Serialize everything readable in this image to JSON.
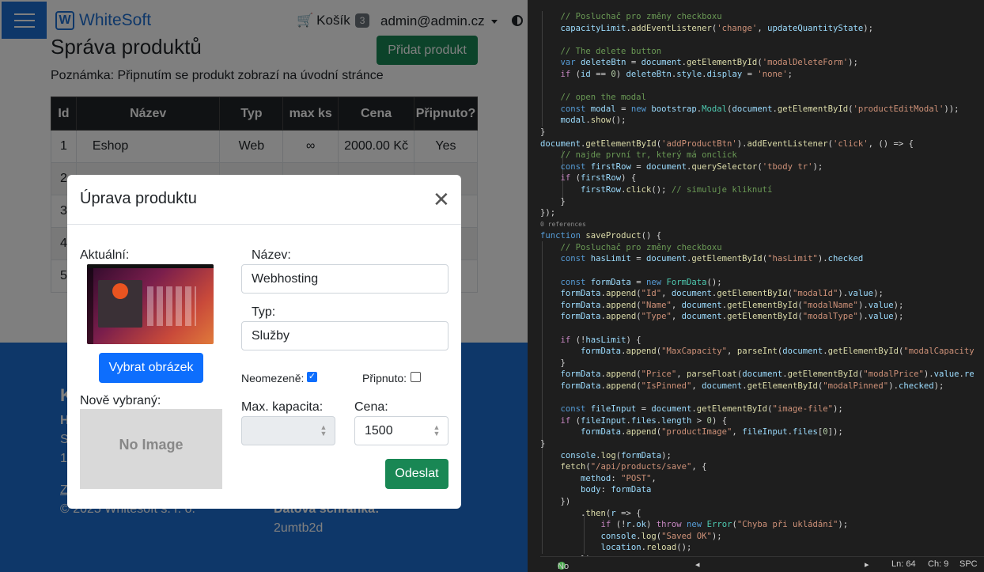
{
  "navbar": {
    "brand": "WhiteSoft",
    "cart_label": "Košík",
    "cart_count": "3",
    "user": "admin@admin.cz"
  },
  "page": {
    "title": "Správa produktů",
    "add_button": "Přidat produkt",
    "note": "Poznámka: Připnutím se produkt zobrazí na úvodní stránce"
  },
  "table": {
    "headers": [
      "Id",
      "Název",
      "Typ",
      "max ks",
      "Cena",
      "Připnuto?"
    ],
    "rows": [
      [
        "1",
        "Eshop",
        "Web",
        "∞",
        "2000.00 Kč",
        "Yes"
      ],
      [
        "2",
        "",
        "",
        "",
        "",
        ""
      ],
      [
        "3",
        "",
        "",
        "",
        "",
        ""
      ],
      [
        "4",
        "",
        "",
        "",
        "",
        ""
      ],
      [
        "5",
        "",
        "",
        "",
        "",
        ""
      ]
    ]
  },
  "footer": {
    "fragments": [
      "K",
      "H",
      "S",
      "1",
      "Z",
      "© 2025 Whitesoft s. r. o.",
      "Datová schránka:",
      "2umtb2d"
    ]
  },
  "modal": {
    "title": "Úprava produktu",
    "close": "✕",
    "current_label": "Aktuální:",
    "pick_button": "Vybrat obrázek",
    "new_label": "Nově vybraný:",
    "no_image": "No Image",
    "name_label": "Název:",
    "name_value": "Webhosting",
    "type_label": "Typ:",
    "type_value": "Služby",
    "unlimited_label": "Neomezeně:",
    "unlimited_checked": true,
    "pinned_label": "Připnuto:",
    "pinned_checked": false,
    "capacity_label": "Max. kapacita:",
    "capacity_value": "",
    "price_label": "Cena:",
    "price_value": "1500",
    "submit": "Odeslat"
  },
  "editor": {
    "status_issues": "No issues found",
    "ln": "Ln: 64",
    "ch": "Ch: 9",
    "mode": "SPC"
  }
}
